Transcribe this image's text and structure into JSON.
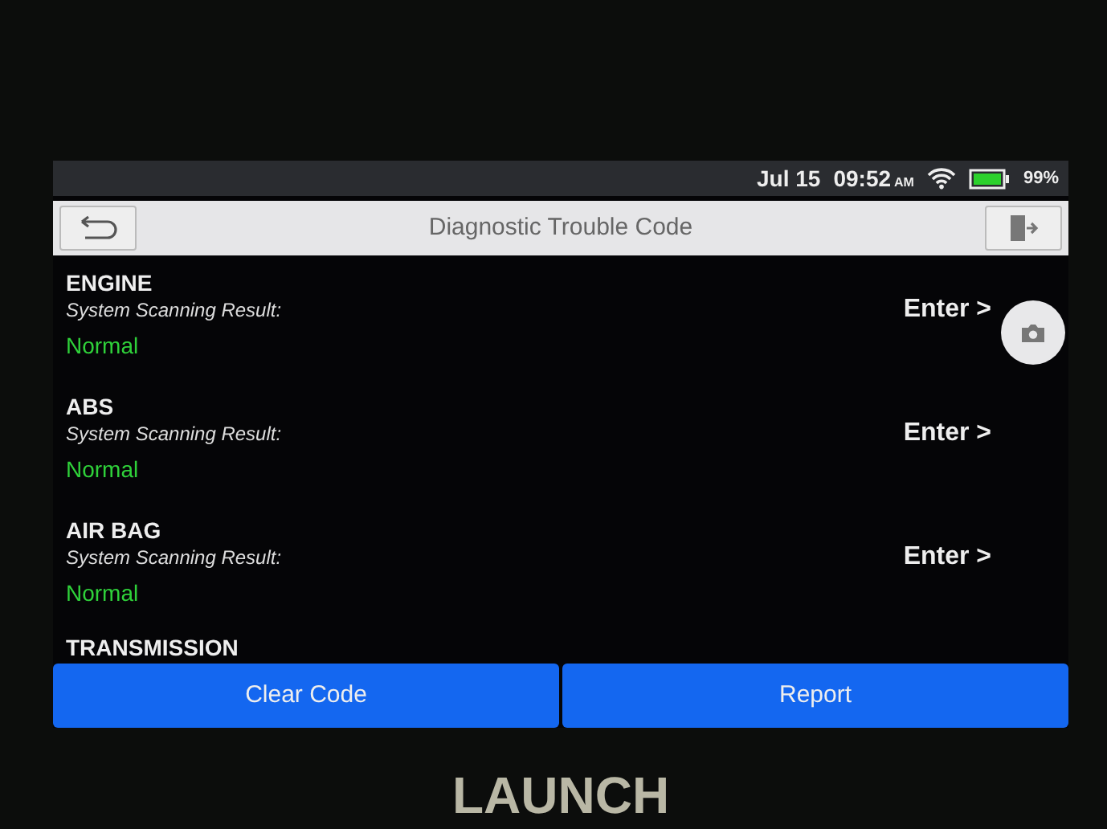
{
  "status_bar": {
    "date": "Jul 15",
    "time": "09:52",
    "ampm": "AM",
    "battery": "99%"
  },
  "header": {
    "title": "Diagnostic Trouble Code"
  },
  "systems": [
    {
      "name": "ENGINE",
      "label": "System Scanning Result:",
      "result": "Normal",
      "action": "Enter >"
    },
    {
      "name": "ABS",
      "label": "System Scanning Result:",
      "result": "Normal",
      "action": "Enter >"
    },
    {
      "name": "AIR BAG",
      "label": "System Scanning Result:",
      "result": "Normal",
      "action": "Enter >"
    },
    {
      "name": "TRANSMISSION"
    }
  ],
  "buttons": [
    "Clear Code",
    "Report"
  ],
  "brand": "LAUNCH"
}
